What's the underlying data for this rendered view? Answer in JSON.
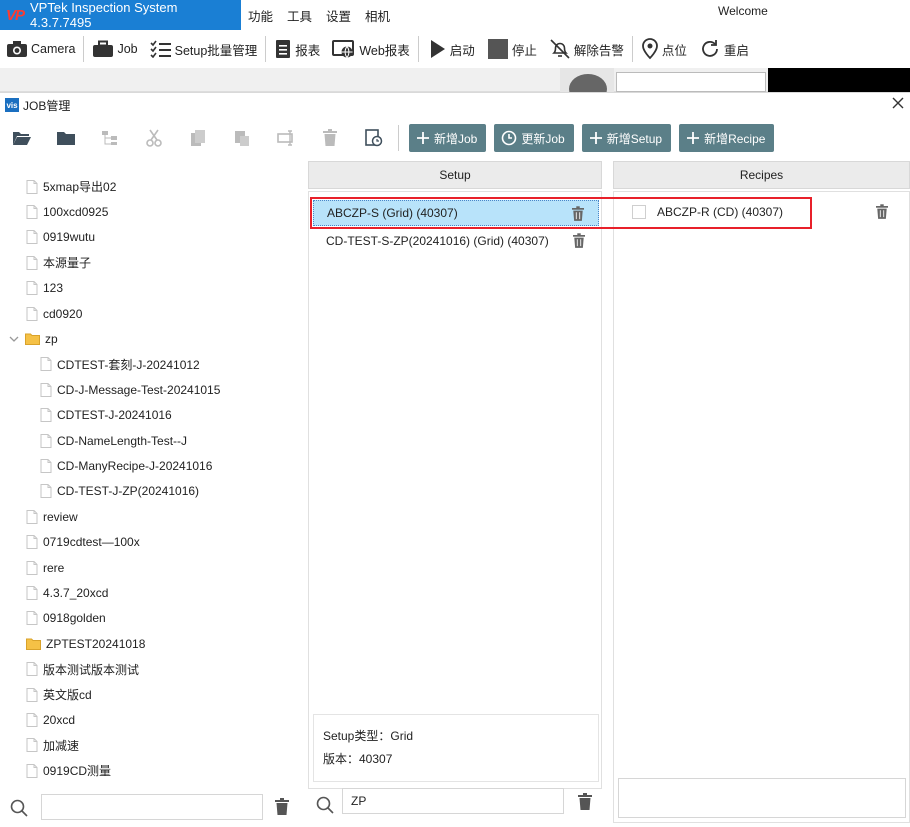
{
  "app": {
    "logo": "VP",
    "title": "VPTek Inspection System 4.3.7.7495",
    "welcome": "Welcome",
    "menus": [
      "功能",
      "工具",
      "设置",
      "相机"
    ]
  },
  "toolbar": {
    "camera": "Camera",
    "job": "Job",
    "setup_batch": "Setup批量管理",
    "report": "报表",
    "web_report": "Web报表",
    "start": "启动",
    "stop": "停止",
    "clear_alarm": "解除告警",
    "point": "点位",
    "restart": "重启"
  },
  "dialog": {
    "icon_text": "vis",
    "title": "JOB管理",
    "actions": {
      "new_job": "新增Job",
      "update_job": "更新Job",
      "new_setup": "新增Setup",
      "new_recipe": "新增Recipe"
    }
  },
  "tree": [
    {
      "label": "5xmap导出02",
      "type": "file",
      "level": 0
    },
    {
      "label": "100xcd0925",
      "type": "file",
      "level": 0
    },
    {
      "label": "0919wutu",
      "type": "file",
      "level": 0
    },
    {
      "label": "本源量子",
      "type": "file",
      "level": 0
    },
    {
      "label": "123",
      "type": "file",
      "level": 0
    },
    {
      "label": "cd0920",
      "type": "file",
      "level": 0
    },
    {
      "label": "zp",
      "type": "folder-open",
      "level": 0
    },
    {
      "label": "CDTEST-套刻-J-20241012",
      "type": "file",
      "level": 1
    },
    {
      "label": "CD-J-Message-Test-20241015",
      "type": "file",
      "level": 1
    },
    {
      "label": "CDTEST-J-20241016",
      "type": "file",
      "level": 1
    },
    {
      "label": "CD-NameLength-Test--J",
      "type": "file",
      "level": 1
    },
    {
      "label": "CD-ManyRecipe-J-20241016",
      "type": "file",
      "level": 1
    },
    {
      "label": "CD-TEST-J-ZP(20241016)",
      "type": "file",
      "level": 1
    },
    {
      "label": "review",
      "type": "file",
      "level": 0
    },
    {
      "label": "0719cdtest—100x",
      "type": "file",
      "level": 0
    },
    {
      "label": "rere",
      "type": "file",
      "level": 0
    },
    {
      "label": "4.3.7_20xcd",
      "type": "file",
      "level": 0
    },
    {
      "label": "0918golden",
      "type": "file",
      "level": 0
    },
    {
      "label": "ZPTEST20241018",
      "type": "folder",
      "level": 0
    },
    {
      "label": "版本测试版本测试",
      "type": "file",
      "level": 0
    },
    {
      "label": "英文版cd",
      "type": "file",
      "level": 0
    },
    {
      "label": "20xcd",
      "type": "file",
      "level": 0
    },
    {
      "label": "加减速",
      "type": "file",
      "level": 0
    },
    {
      "label": "0919CD测量",
      "type": "file",
      "level": 0
    }
  ],
  "left_search": {
    "value": ""
  },
  "setup": {
    "header": "Setup",
    "items": [
      {
        "label": "ABCZP-S (Grid) (40307)",
        "selected": true
      },
      {
        "label": "CD-TEST-S-ZP(20241016) (Grid) (40307)",
        "selected": false
      }
    ],
    "info": {
      "type_line": "Setup类型：Grid",
      "version_line": "版本：40307"
    },
    "search_value": "ZP"
  },
  "recipes": {
    "header": "Recipes",
    "items": [
      {
        "label": "ABCZP-R (CD) (40307)",
        "checked": false
      }
    ],
    "search_value": ""
  },
  "colors": {
    "brand": "#1a7fd4",
    "action_button": "#5b7f88",
    "selection": "#b8e3fa",
    "highlight_box": "#e8202a"
  }
}
